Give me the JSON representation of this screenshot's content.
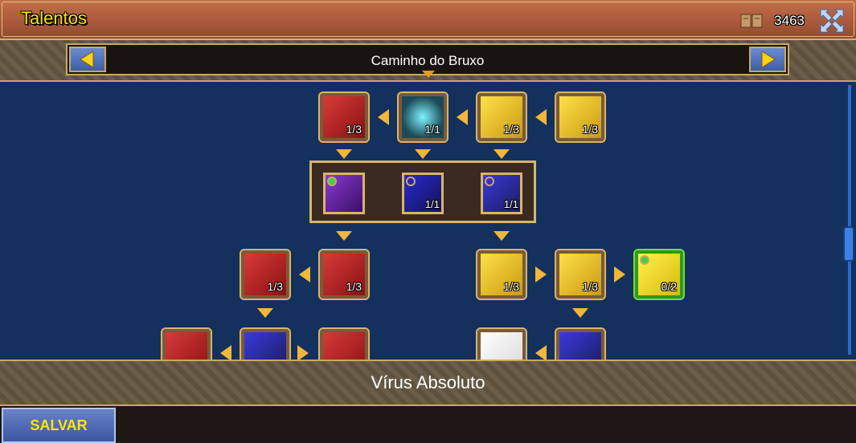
{
  "header": {
    "title": "Talentos",
    "points": "3463",
    "icons": [
      "book-icon",
      "close-icon"
    ]
  },
  "path": {
    "label": "Caminho do Bruxo",
    "prev_icon": "arrow-left-icon",
    "next_icon": "arrow-right-icon"
  },
  "nodes": {
    "r1c1": "1/3",
    "r1c2": "1/1",
    "r1c3": "1/3",
    "r1c4": "1/3",
    "choice2": "1/1",
    "choice3": "1/1",
    "r3c1": "1/3",
    "r3c2": "1/3",
    "r3c3": "1/3",
    "r3c4": "1/3",
    "r3c5": "0/2"
  },
  "info": {
    "selected_talent": "Vírus Absoluto"
  },
  "footer": {
    "save_label": "SALVAR"
  },
  "colors": {
    "title_text": "#ffe600",
    "tree_bg": "#13315c",
    "frame_gold": "#d7b56a"
  }
}
